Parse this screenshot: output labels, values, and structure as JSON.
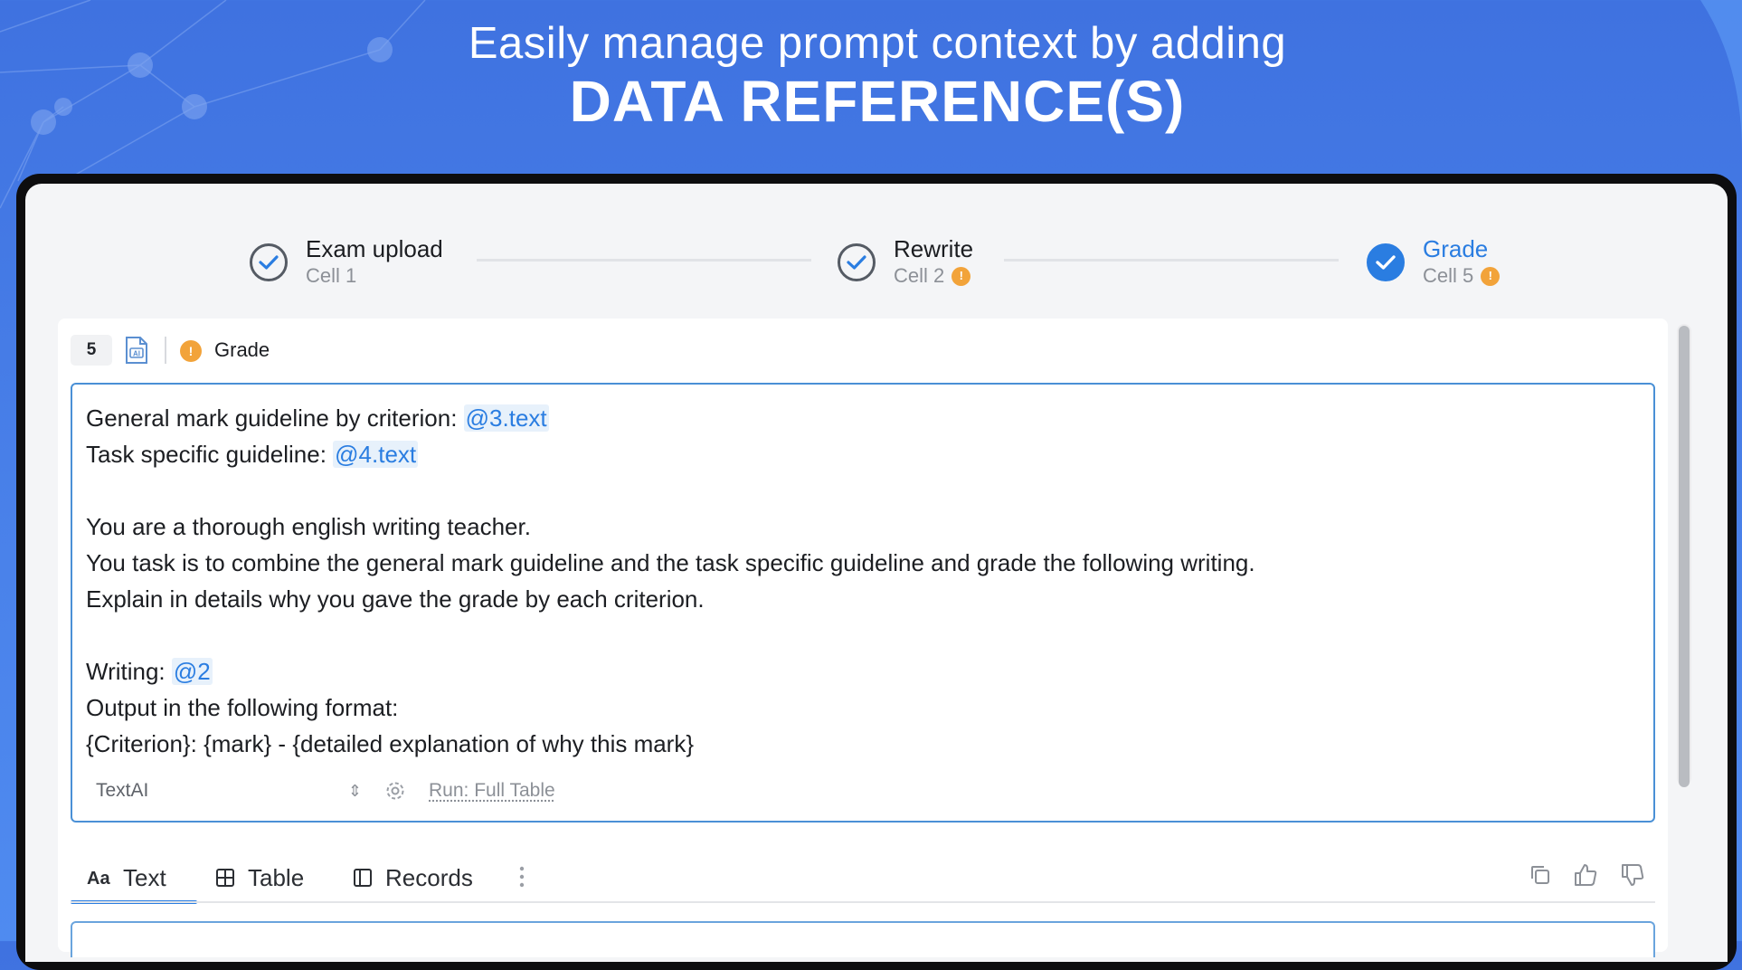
{
  "banner": {
    "headline": "Easily manage prompt context by adding",
    "headline_emphasis": "DATA REFERENCE(S)"
  },
  "stepper": {
    "steps": [
      {
        "title": "Exam upload",
        "subtitle": "Cell 1",
        "state": "completed",
        "warning": false
      },
      {
        "title": "Rewrite",
        "subtitle": "Cell 2",
        "state": "completed",
        "warning": true
      },
      {
        "title": "Grade",
        "subtitle": "Cell 5",
        "state": "active",
        "warning": true
      }
    ]
  },
  "cell": {
    "number": "5",
    "name": "Grade",
    "status": "warning",
    "prompt": {
      "line1_text": "General mark guideline by criterion: ",
      "line1_ref": "@3.text",
      "line2_text": "Task specific guideline: ",
      "line2_ref": "@4.text",
      "line4": "You are a thorough english writing teacher.",
      "line5": "You task is to combine the general mark guideline and the task specific guideline and grade the following writing.",
      "line6": "Explain in details why you gave the grade by each criterion.",
      "line8_text": "Writing: ",
      "line8_ref": "@2",
      "line9": "Output in the following format:",
      "line10": "{Criterion}: {mark} - {detailed explanation of why this mark}"
    },
    "model_select": {
      "value": "TextAI"
    },
    "run_label": "Run: Full Table"
  },
  "output_tabs": [
    {
      "label": "Text",
      "icon": "text-format-icon",
      "selected": true
    },
    {
      "label": "Table",
      "icon": "table-grid-icon",
      "selected": false
    },
    {
      "label": "Records",
      "icon": "records-panel-icon",
      "selected": false
    }
  ],
  "output_actions": [
    "copy-icon",
    "thumbs-up-icon",
    "thumbs-down-icon"
  ],
  "colors": {
    "accent": "#2a7de1",
    "warning": "#f2a33a",
    "banner": "#4a82ea"
  }
}
